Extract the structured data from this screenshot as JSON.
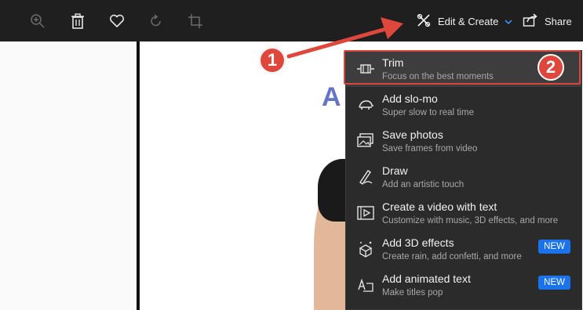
{
  "toolbar": {
    "icons": [
      "zoom-in-icon",
      "delete-icon",
      "favorite-icon",
      "rotate-icon",
      "crop-icon"
    ],
    "edit_create_label": "Edit & Create",
    "share_label": "Share"
  },
  "menu": {
    "items": [
      {
        "title": "Trim",
        "subtitle": "Focus on the best moments",
        "icon": "trim-icon",
        "badge": ""
      },
      {
        "title": "Add slo-mo",
        "subtitle": "Super slow to real time",
        "icon": "turtle-icon",
        "badge": ""
      },
      {
        "title": "Save photos",
        "subtitle": "Save frames from video",
        "icon": "save-photos-icon",
        "badge": ""
      },
      {
        "title": "Draw",
        "subtitle": "Add an artistic touch",
        "icon": "draw-icon",
        "badge": ""
      },
      {
        "title": "Create a video with text",
        "subtitle": "Customize with music, 3D effects, and more",
        "icon": "video-text-icon",
        "badge": ""
      },
      {
        "title": "Add 3D effects",
        "subtitle": "Create rain, add confetti, and more",
        "icon": "3d-effects-icon",
        "badge": "NEW"
      },
      {
        "title": "Add animated text",
        "subtitle": "Make titles pop",
        "icon": "animated-text-icon",
        "badge": "NEW"
      }
    ]
  },
  "annotations": {
    "step1": "1",
    "step2": "2"
  },
  "colors": {
    "toolbar_bg": "#1f1f1f",
    "menu_bg": "#2b2b2b",
    "accent": "#1a73e8",
    "annotation": "#e0473c"
  }
}
